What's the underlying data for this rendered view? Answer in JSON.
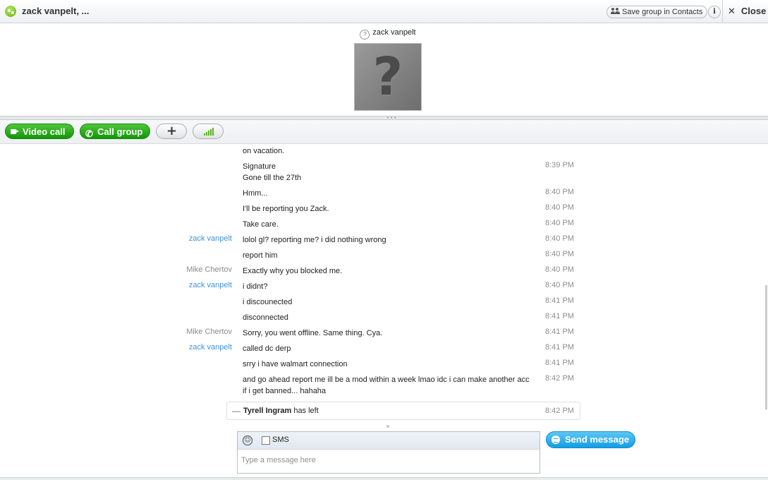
{
  "window": {
    "title": "zack vanpelt, ...",
    "save_group_label": "Save group in Contacts",
    "info_label": "i",
    "close_glyph": "✕",
    "close_label": "Close"
  },
  "profile": {
    "name": "zack vanpelt",
    "status_glyph": "?",
    "avatar_glyph": "?"
  },
  "actions": {
    "video_call": "Video call",
    "call_group": "Call group",
    "add_glyph": "+"
  },
  "messages": [
    {
      "sender": "",
      "sender_type": "",
      "text": "on vacation.",
      "time": ""
    },
    {
      "sender": "",
      "sender_type": "",
      "text": "Signature\nGone till the 27th",
      "time": "8:39 PM"
    },
    {
      "sender": "",
      "sender_type": "",
      "text": "Hmm...",
      "time": "8:40 PM"
    },
    {
      "sender": "",
      "sender_type": "",
      "text": "I'll be reporting you Zack.",
      "time": "8:40 PM"
    },
    {
      "sender": "",
      "sender_type": "",
      "text": "Take care.",
      "time": "8:40 PM"
    },
    {
      "sender": "zack vanpelt",
      "sender_type": "zack",
      "text": "lolol gl? reporting me? i did nothing wrong",
      "time": "8:40 PM"
    },
    {
      "sender": "",
      "sender_type": "",
      "text": "report him",
      "time": "8:40 PM"
    },
    {
      "sender": "Mike Chertov",
      "sender_type": "mike",
      "text": "Exactly why you blocked me.",
      "time": "8:40 PM"
    },
    {
      "sender": "zack vanpelt",
      "sender_type": "zack",
      "text": "i didnt?",
      "time": "8:40 PM"
    },
    {
      "sender": "",
      "sender_type": "",
      "text": "i discounected",
      "time": "8:41 PM"
    },
    {
      "sender": "",
      "sender_type": "",
      "text": "disconnected",
      "time": "8:41 PM"
    },
    {
      "sender": "Mike Chertov",
      "sender_type": "mike",
      "text": "Sorry, you went offline. Same thing. Cya.",
      "time": "8:41 PM"
    },
    {
      "sender": "zack vanpelt",
      "sender_type": "zack",
      "text": "called dc derp",
      "time": "8:41 PM"
    },
    {
      "sender": "",
      "sender_type": "",
      "text": "srry i have walmart connection",
      "time": "8:41 PM"
    },
    {
      "sender": "",
      "sender_type": "",
      "text": " and go ahead report me ill be a mod within a week lmao idc i can make another acc if i get banned... hahaha",
      "time": "8:42 PM"
    }
  ],
  "event": {
    "collapse_glyph": "—",
    "name": "Tyrell Ingram",
    "text": " has left",
    "time": "8:42 PM"
  },
  "compose": {
    "smiley_glyph": "☺",
    "sms_label": "SMS",
    "sms_checked": false,
    "placeholder": "Type a message here",
    "value": "",
    "send_label": "Send message"
  },
  "colors": {
    "sender_zack": "#3f93d8",
    "sender_mike": "#8a8a8a",
    "green_button": "#13960a",
    "send_button": "#119de4",
    "quality_bars": "#5cb31d"
  }
}
